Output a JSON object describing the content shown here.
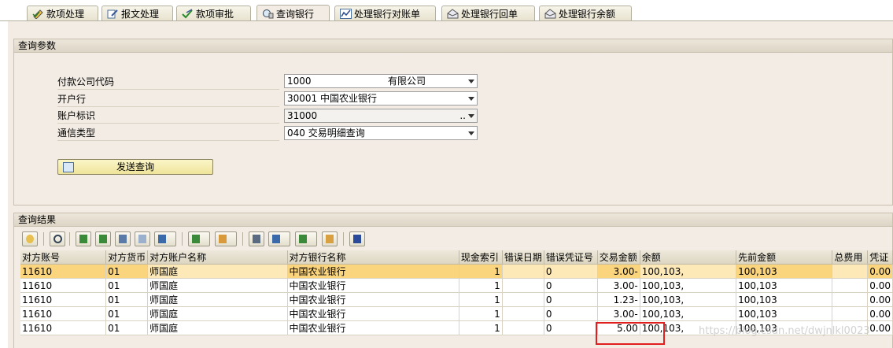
{
  "tabs": [
    {
      "label": "款项处理",
      "icon": "pen-check-icon"
    },
    {
      "label": "报文处理",
      "icon": "pen-edit-icon"
    },
    {
      "label": "款项审批",
      "icon": "checkmark-icon"
    },
    {
      "label": "查询银行",
      "icon": "bank-query-icon"
    },
    {
      "label": "处理银行对账单",
      "icon": "chart-line-icon"
    },
    {
      "label": "处理银行回单",
      "icon": "inbox-icon"
    },
    {
      "label": "处理银行余额",
      "icon": "inbox-icon"
    }
  ],
  "query_params": {
    "title": "查询参数",
    "fields": [
      {
        "label": "付款公司代码",
        "value": "1000",
        "extra": "有限公司"
      },
      {
        "label": "开户行",
        "value": "30001 中国农业银行",
        "extra": ""
      },
      {
        "label": "账户标识",
        "value": "31000",
        "extra": ".."
      },
      {
        "label": "通信类型",
        "value": "040 交易明细查询",
        "extra": ""
      }
    ],
    "submit_label": "发送查询"
  },
  "results": {
    "title": "查询结果",
    "toolbar_icons": [
      "details-icon",
      "search-icon",
      "sort-asc-icon",
      "sort-desc-icon",
      "find-icon",
      "find-next-icon",
      "filter-icon",
      "sum-icon",
      "subtotal-icon",
      "print-icon",
      "views-icon",
      "export-icon",
      "layout-icon",
      "info-icon"
    ],
    "columns": [
      "对方账号",
      "对方货币",
      "对方账户名称",
      "对方银行名称",
      "现金索引",
      "错误日期",
      "错误凭证号",
      "交易金额",
      "余额",
      "先前金额",
      "总费用",
      "凭证"
    ],
    "rows": [
      [
        "11610",
        "01",
        "师国庭",
        "中国农业银行",
        "1",
        "",
        "0",
        "3.00-",
        "100,103,",
        "100,103",
        "",
        "0.00"
      ],
      [
        "11610",
        "01",
        "师国庭",
        "中国农业银行",
        "1",
        "",
        "0",
        "3.00-",
        "100,103,",
        "100,103",
        "",
        "0.00"
      ],
      [
        "11610",
        "01",
        "师国庭",
        "中国农业银行",
        "1",
        "",
        "0",
        "1.23-",
        "100,103,",
        "100,103",
        "",
        "0.00"
      ],
      [
        "11610",
        "01",
        "师国庭",
        "中国农业银行",
        "1",
        "",
        "0",
        "3.00-",
        "100,103,",
        "100,103",
        "",
        "0.00"
      ],
      [
        "11610",
        "01",
        "师国庭",
        "中国农业银行",
        "1",
        "",
        "0",
        "5.00",
        "100,103,",
        "100,103",
        "",
        "0.00"
      ]
    ]
  },
  "watermark": "https://blog.csdn.net/dwjnlkl0023"
}
